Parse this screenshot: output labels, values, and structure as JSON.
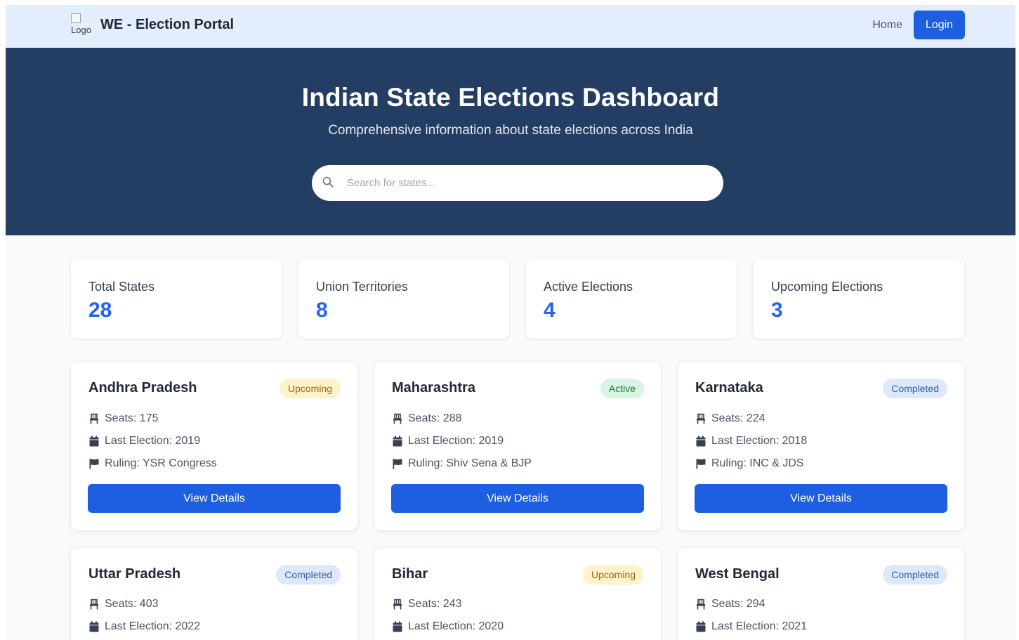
{
  "navbar": {
    "logo_alt": "Logo",
    "title": "WE - Election Portal",
    "home_label": "Home",
    "login_label": "Login"
  },
  "hero": {
    "title": "Indian State Elections Dashboard",
    "subtitle": "Comprehensive information about state elections across India",
    "search_placeholder": "Search for states...",
    "search_value": ""
  },
  "stats": [
    {
      "label": "Total States",
      "value": "28"
    },
    {
      "label": "Union Territories",
      "value": "8"
    },
    {
      "label": "Active Elections",
      "value": "4"
    },
    {
      "label": "Upcoming Elections",
      "value": "3"
    }
  ],
  "states": [
    {
      "name": "Andhra Pradesh",
      "status": "Upcoming",
      "seats": "Seats: 175",
      "last_election": "Last Election: 2019",
      "ruling": "Ruling: YSR Congress",
      "button": "View Details"
    },
    {
      "name": "Maharashtra",
      "status": "Active",
      "seats": "Seats: 288",
      "last_election": "Last Election: 2019",
      "ruling": "Ruling: Shiv Sena & BJP",
      "button": "View Details"
    },
    {
      "name": "Karnataka",
      "status": "Completed",
      "seats": "Seats: 224",
      "last_election": "Last Election: 2018",
      "ruling": "Ruling: INC & JDS",
      "button": "View Details"
    },
    {
      "name": "Uttar Pradesh",
      "status": "Completed",
      "seats": "Seats: 403",
      "last_election": "Last Election: 2022"
    },
    {
      "name": "Bihar",
      "status": "Upcoming",
      "seats": "Seats: 243",
      "last_election": "Last Election: 2020"
    },
    {
      "name": "West Bengal",
      "status": "Completed",
      "seats": "Seats: 294",
      "last_election": "Last Election: 2021"
    }
  ],
  "colors": {
    "nav_bg": "#e3edfb",
    "hero_bg": "#233d63",
    "primary": "#1d5fe0",
    "stat_value": "#2563eb",
    "badge_upcoming": "#fdf3c8",
    "badge_active": "#d7f5e2",
    "badge_completed": "#dde8fb"
  },
  "icons": {
    "seats": "chair-icon",
    "last_election": "calendar-icon",
    "ruling": "flag-icon",
    "search": "search-icon"
  }
}
